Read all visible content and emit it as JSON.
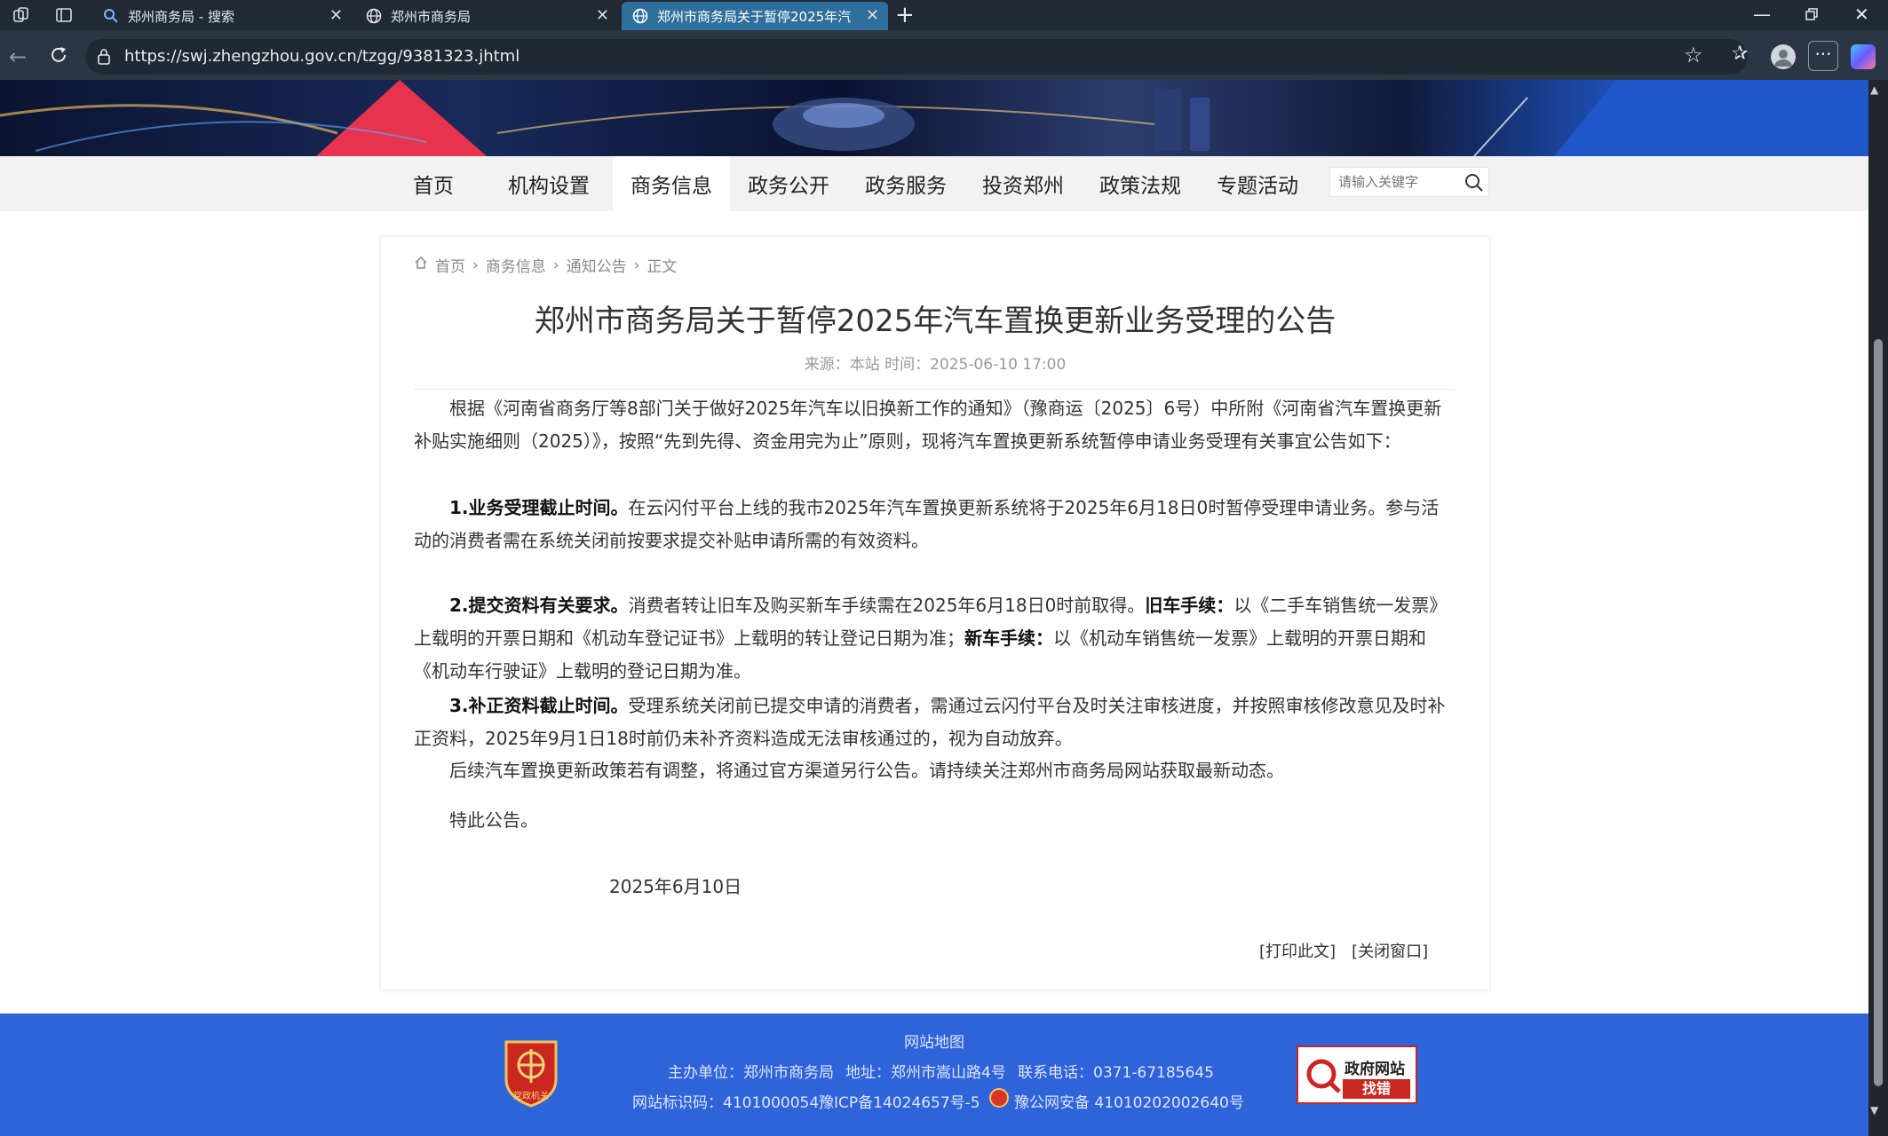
{
  "browser": {
    "tabs": [
      {
        "label": "郑州商务局 - 搜索",
        "active": false
      },
      {
        "label": "郑州市商务局",
        "active": false
      },
      {
        "label": "郑州市商务局关于暂停2025年汽",
        "active": true
      }
    ],
    "url": "https://swj.zhengzhou.gov.cn/tzgg/9381323.jhtml"
  },
  "nav": {
    "items": [
      "首页",
      "机构设置",
      "商务信息",
      "政务公开",
      "政务服务",
      "投资郑州",
      "政策法规",
      "专题活动"
    ],
    "active_index": 2,
    "search_placeholder": "请输入关键字"
  },
  "breadcrumb": [
    "首页",
    "商务信息",
    "通知公告",
    "正文"
  ],
  "article": {
    "title": "郑州市商务局关于暂停2025年汽车置换更新业务受理的公告",
    "meta": "来源：本站 时间：2025-06-10 17:00",
    "intro": "根据《河南省商务厅等8部门关于做好2025年汽车以旧换新工作的通知》（豫商运〔2025〕6号）中所附《河南省汽车置换更新补贴实施细则（2025）》，按照“先到先得、资金用完为止”原则，现将汽车置换更新系统暂停申请业务受理有关事宜公告如下：",
    "p1_title": "1.业务受理截止时间。",
    "p1_text": "在云闪付平台上线的我市2025年汽车置换更新系统将于2025年6月18日0时暂停受理申请业务。参与活动的消费者需在系统关闭前按要求提交补贴申请所需的有效资料。",
    "p2_title": "2.提交资料有关要求。",
    "p2_text_a": "消费者转让旧车及购买新车手续需在2025年6月18日0时前取得。",
    "p2_old_label": "旧车手续：",
    "p2_text_b": "以《二手车销售统一发票》上载明的开票日期和《机动车登记证书》上载明的转让登记日期为准；",
    "p2_new_label": "新车手续：",
    "p2_text_c": "以《机动车销售统一发票》上载明的开票日期和《机动车行驶证》上载明的登记日期为准。",
    "p3_title": "3.补正资料截止时间。",
    "p3_text": "受理系统关闭前已提交申请的消费者，需通过云闪付平台及时关注审核进度，并按照审核修改意见及时补正资料，2025年9月1日18时前仍未补齐资料造成无法审核通过的，视为自动放弃。",
    "p4": "后续汽车置换更新政策若有调整，将通过官方渠道另行公告。请持续关注郑州市商务局网站获取最新动态。",
    "p5": "特此公告。",
    "date": "2025年6月10日",
    "print_label": "[打印此文]",
    "close_label": "[关闭窗口]"
  },
  "footer": {
    "sitemap": "网站地图",
    "host": "主办单位：郑州市商务局",
    "address": "地址：郑州市嵩山路4号",
    "phone": "联系电话：0371-67185645",
    "site_id": "网站标识码：4101000054",
    "icp": "豫ICP备14024657号-5",
    "police": "豫公网安备 41010202002640号",
    "badge_line1": "政府网站",
    "badge_line2": "找错",
    "emblem_text": "党政机关"
  },
  "colors": {
    "footer_bg": "#2f63d9",
    "tab_active": "#2f6f9c",
    "nav_bg": "#f2f2f2"
  }
}
